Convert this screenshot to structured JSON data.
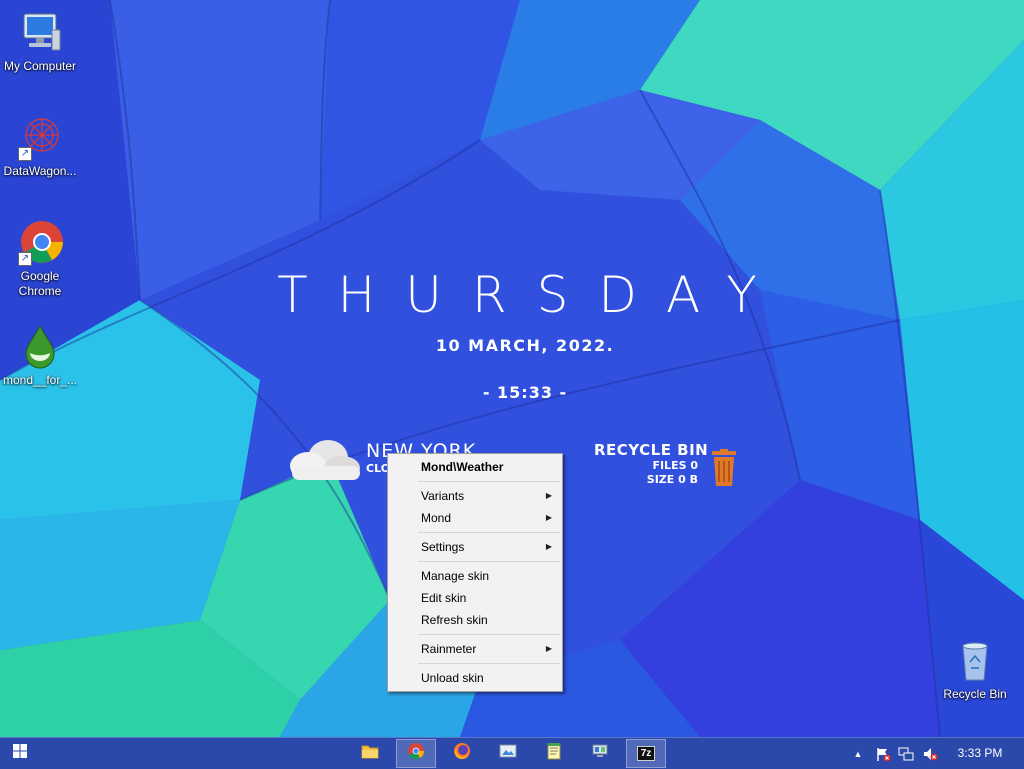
{
  "desktop": {
    "icons": [
      {
        "label": "My Computer",
        "icon": "computer-icon"
      },
      {
        "label": "DataWagon...",
        "icon": "datawagon-icon"
      },
      {
        "label": "Google Chrome",
        "icon": "chrome-icon"
      },
      {
        "label": "mond__for_...",
        "icon": "mond-icon"
      },
      {
        "label": "Recycle Bin",
        "icon": "recycle-bin-icon"
      }
    ]
  },
  "rainmeter": {
    "day": "THURSDAY",
    "date": "10 MARCH, 2022.",
    "time": "- 15:33 -",
    "weather": {
      "city": "NEW YORK",
      "condition": "CLO"
    },
    "recycle": {
      "title": "RECYCLE BIN",
      "files": "FILES 0",
      "size": "SIZE 0 B"
    }
  },
  "context_menu": {
    "title": "Mond\\Weather",
    "items": {
      "variants": "Variants",
      "mond": "Mond",
      "settings": "Settings",
      "manage_skin": "Manage skin",
      "edit_skin": "Edit skin",
      "refresh_skin": "Refresh skin",
      "rainmeter": "Rainmeter",
      "unload_skin": "Unload skin"
    },
    "submenu_arrow": "▶"
  },
  "taskbar": {
    "start_icon": "windows-logo-icon",
    "apps": [
      "file-explorer-icon",
      "chrome-icon",
      "firefox-icon",
      "image-viewer-icon",
      "notepad-icon",
      "network-tool-icon",
      "7zip-icon"
    ],
    "tray_icons": [
      "show-hidden-icons",
      "action-center-flag-icon",
      "network-icon",
      "volume-muted-icon"
    ],
    "show_hidden_arrow": "▲",
    "clock": "3:33 PM",
    "zip_label": "7z"
  }
}
